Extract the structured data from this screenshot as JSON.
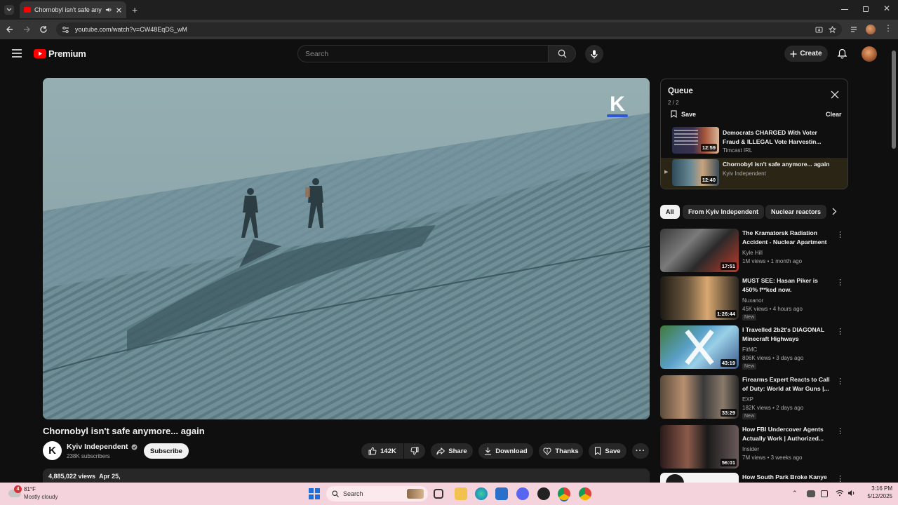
{
  "browser": {
    "tab_title": "Chornobyl isn't safe anymo",
    "url": "youtube.com/watch?v=CW48EqDS_wM"
  },
  "header": {
    "logo_text": "Premium",
    "search_placeholder": "Search",
    "create_label": "Create"
  },
  "video": {
    "title": "Chornobyl isn't safe anymore... again",
    "channel": "Kyiv Independent",
    "subscribers": "238K subscribers",
    "subscribe_label": "Subscribe",
    "likes": "142K",
    "share_label": "Share",
    "download_label": "Download",
    "thanks_label": "Thanks",
    "save_label": "Save",
    "views": "4,885,022 views",
    "date": "Apr 25,",
    "watermark": "K"
  },
  "queue": {
    "title": "Queue",
    "count": "2 / 2",
    "save_label": "Save",
    "clear_label": "Clear",
    "items": [
      {
        "title": "Democrats CHARGED With Voter Fraud & ILLEGAL Vote Harvestin...",
        "channel": "Timcast IRL",
        "duration": "12:59"
      },
      {
        "title": "Chornobyl isn't safe anymore... again",
        "channel": "Kyiv Independent",
        "duration": "12:40"
      }
    ]
  },
  "chips": [
    "All",
    "From Kyiv Independent",
    "Nuclear reactors"
  ],
  "recommendations": [
    {
      "title": "The Kramatorsk Radiation Accident - Nuclear Apartment",
      "channel": "Kyle Hill",
      "meta": "1M views • 1 month ago",
      "duration": "17:51",
      "badge": ""
    },
    {
      "title": "MUST SEE: Hasan Piker is 450% f**ked now.",
      "channel": "Nuxanor",
      "meta": "45K views • 4 hours ago",
      "duration": "1:26:44",
      "badge": "New"
    },
    {
      "title": "I Travelled 2b2t's DIAGONAL Minecraft Highways",
      "channel": "FitMC",
      "meta": "806K views • 3 days ago",
      "duration": "43:19",
      "badge": "New"
    },
    {
      "title": "Firearms Expert Reacts to Call of Duty: World at War Guns |...",
      "channel": "EXP",
      "meta": "182K views • 2 days ago",
      "duration": "33:29",
      "badge": "New"
    },
    {
      "title": "How FBI Undercover Agents Actually Work | Authorized...",
      "channel": "Insider",
      "meta": "7M views • 3 weeks ago",
      "duration": "56:01",
      "badge": ""
    },
    {
      "title": "How South Park Broke Kanye",
      "channel": "",
      "meta": "",
      "duration": "",
      "badge": ""
    }
  ],
  "taskbar": {
    "weather_temp": "81°F",
    "weather_desc": "Mostly cloudy",
    "weather_badge": "4",
    "search_label": "Search",
    "time": "3:16 PM",
    "date": "5/12/2025"
  },
  "colors": {
    "brand": "#ff0000",
    "accent": "#3ea6ff",
    "taskbar": "#f5d3dc"
  }
}
